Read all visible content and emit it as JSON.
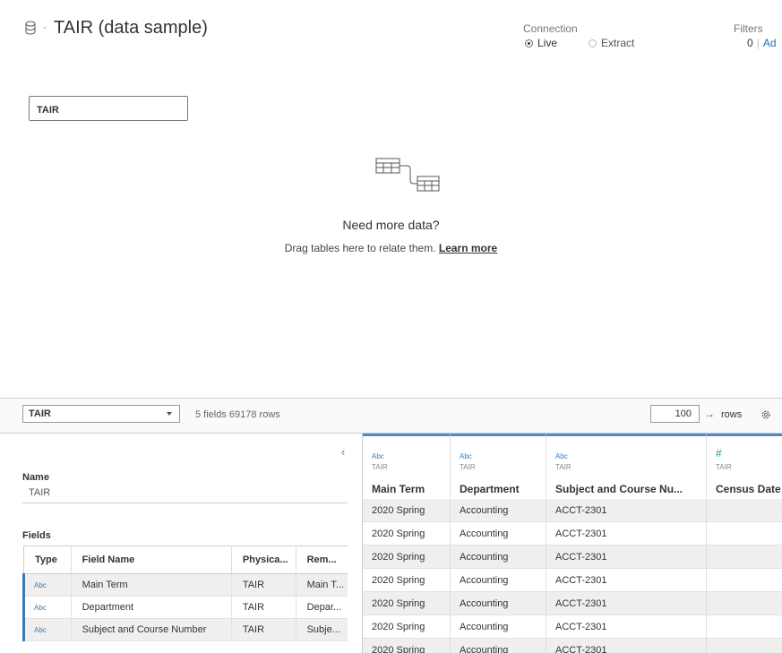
{
  "header": {
    "title": "TAIR (data sample)",
    "datasource_icon": "database-icon"
  },
  "connection": {
    "label": "Connection",
    "live": "Live",
    "extract": "Extract",
    "selected": "Live"
  },
  "filters": {
    "label": "Filters",
    "count": "0",
    "add": "Ad"
  },
  "canvas": {
    "table_name": "TAIR",
    "relate_icon": "relate-tables-icon",
    "heading": "Need more data?",
    "hint": "Drag tables here to relate them.",
    "learn_more": "Learn more"
  },
  "toolbar": {
    "table_select": "TAIR",
    "field_summary": "5 fields 69178 rows",
    "rows_value": "100",
    "rows_label": "rows",
    "settings_icon": "gear-icon"
  },
  "metadata": {
    "name_label": "Name",
    "name_value": "TAIR",
    "fields_label": "Fields",
    "columns": [
      "Type",
      "Field Name",
      "Physica...",
      "Rem..."
    ],
    "rows": [
      {
        "type": "Abc",
        "field": "Main Term",
        "physical": "TAIR",
        "remote": "Main T..."
      },
      {
        "type": "Abc",
        "field": "Department",
        "physical": "TAIR",
        "remote": "Depar..."
      },
      {
        "type": "Abc",
        "field": "Subject and Course Number",
        "physical": "TAIR",
        "remote": "Subje..."
      }
    ]
  },
  "grid": {
    "columns": [
      {
        "type": "Abc",
        "source": "TAIR",
        "name": "Main Term"
      },
      {
        "type": "Abc",
        "source": "TAIR",
        "name": "Department"
      },
      {
        "type": "Abc",
        "source": "TAIR",
        "name": "Subject and Course Nu..."
      },
      {
        "type": "#",
        "source": "TAIR",
        "name": "Census Date"
      }
    ],
    "rows": [
      [
        "2020 Spring",
        "Accounting",
        "ACCT-2301",
        "-"
      ],
      [
        "2020 Spring",
        "Accounting",
        "ACCT-2301",
        "-"
      ],
      [
        "2020 Spring",
        "Accounting",
        "ACCT-2301",
        "-"
      ],
      [
        "2020 Spring",
        "Accounting",
        "ACCT-2301",
        "-"
      ],
      [
        "2020 Spring",
        "Accounting",
        "ACCT-2301",
        "-"
      ],
      [
        "2020 Spring",
        "Accounting",
        "ACCT-2301",
        "-"
      ],
      [
        "2020 Spring",
        "Accounting",
        "ACCT-2301",
        "-"
      ]
    ]
  }
}
